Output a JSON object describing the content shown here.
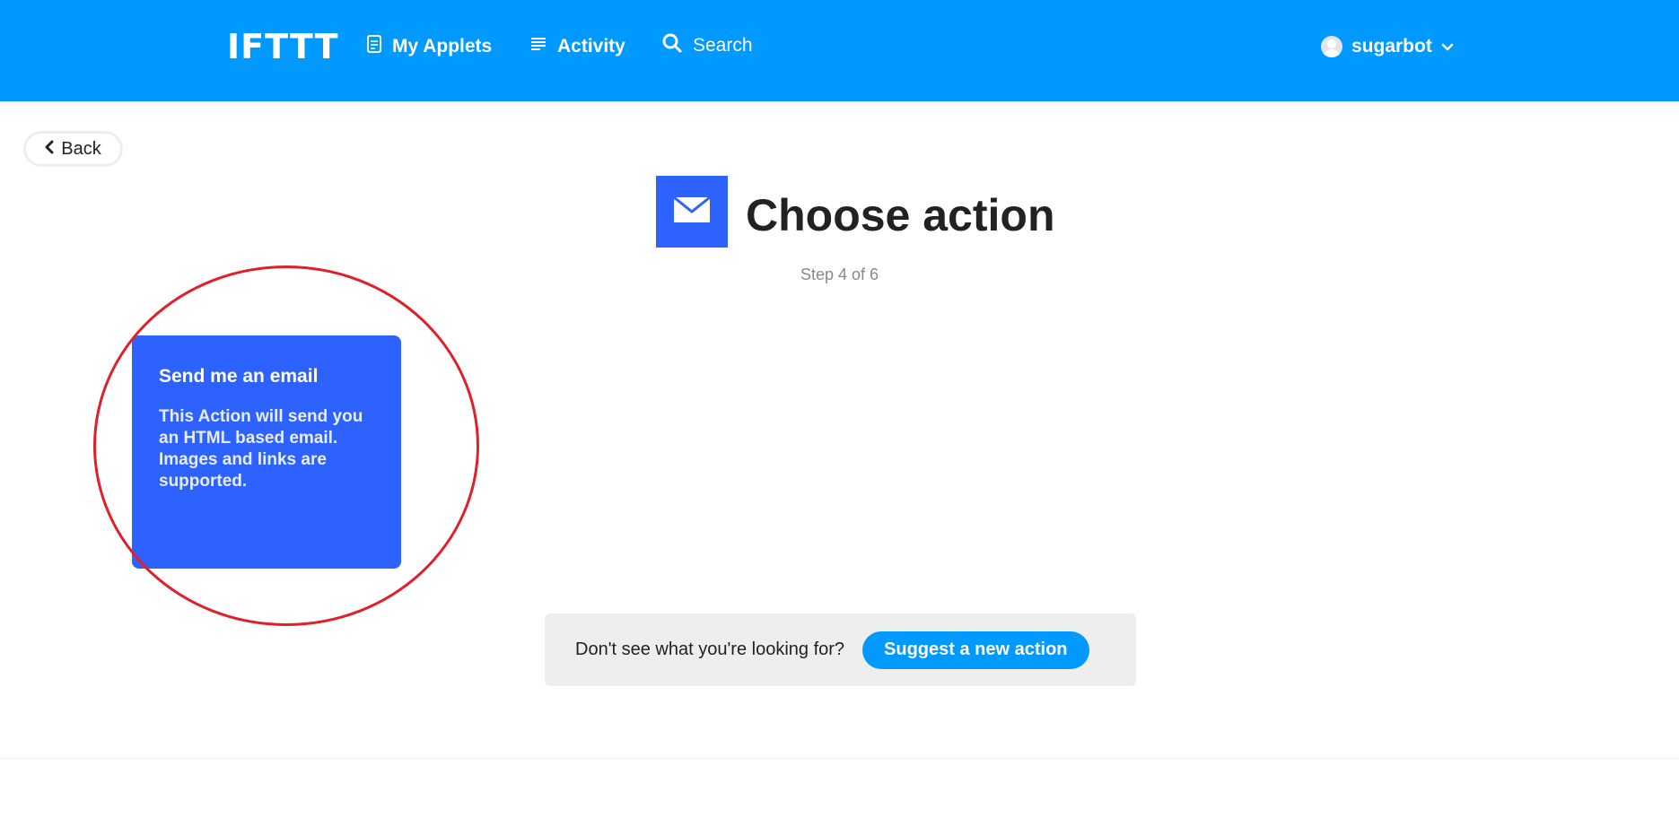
{
  "header": {
    "logo": "IFTTT",
    "nav": {
      "my_applets": "My Applets",
      "activity": "Activity",
      "search": "Search"
    },
    "user": {
      "name": "sugarbot"
    }
  },
  "back": {
    "label": "Back"
  },
  "page": {
    "title": "Choose action",
    "step": "Step 4 of 6"
  },
  "actions": [
    {
      "title": "Send me an email",
      "description": "This Action will send you an HTML based email. Images and links are supported."
    }
  ],
  "suggest": {
    "prompt": "Don't see what you're looking for?",
    "button": "Suggest a new action"
  },
  "colors": {
    "brand_blue": "#0099ff",
    "action_blue": "#2d62ff",
    "highlight_red": "#e01f2a"
  },
  "icons": {
    "applets": "document-icon",
    "activity": "list-icon",
    "search": "search-icon",
    "back": "chevron-left-icon",
    "user_menu": "chevron-down-icon",
    "service": "envelope-icon"
  }
}
